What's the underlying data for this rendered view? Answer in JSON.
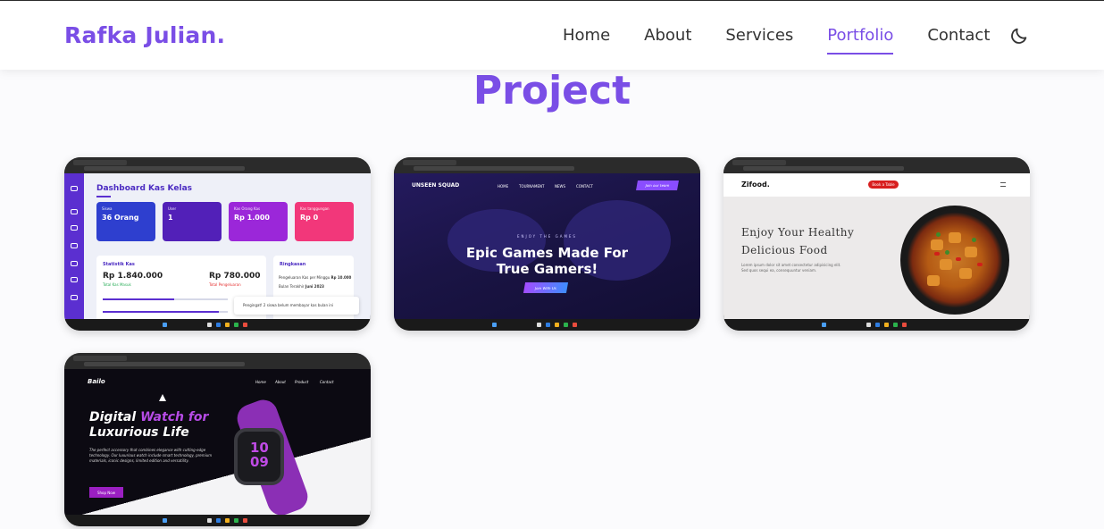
{
  "brand": {
    "name": "Rafka Julian."
  },
  "nav": {
    "items": [
      {
        "label": "Home",
        "active": false
      },
      {
        "label": "About",
        "active": false
      },
      {
        "label": "Services",
        "active": false
      },
      {
        "label": "Portfolio",
        "active": true
      },
      {
        "label": "Contact",
        "active": false
      }
    ],
    "theme_toggle_icon": "moon-icon",
    "accent_color": "#7a4ee6"
  },
  "section": {
    "title": "Project"
  },
  "projects": [
    {
      "screenshot": {
        "title": "Dashboard Kas Kelas",
        "stats": [
          {
            "label": "Siswa",
            "value": "36 Orang",
            "color": "#2e3fcf"
          },
          {
            "label": "User",
            "value": "1",
            "color": "#5220b8"
          },
          {
            "label": "Kas Orang Kas",
            "value": "Rp 1.000",
            "color": "#9b27d9"
          },
          {
            "label": "Kas tanggungan",
            "value": "Rp 0",
            "color": "#f2377a"
          }
        ],
        "statistik_title": "Statistik Kas",
        "amount_in": "Rp 1.840.000",
        "amount_in_label": "Total Kas Masuk",
        "amount_out": "Rp 780.000",
        "amount_out_label": "Total Pengeluaran",
        "ringkasan_title": "Ringkasan",
        "ringkasan_rows": [
          {
            "label": "Pengeluaran Kas per Minggu",
            "value": "Rp 10.000"
          },
          {
            "label": "Bulan Terakhir",
            "value": "Juni 2023"
          }
        ],
        "toast": "Pengingat! 2 siswa belum membayar kas bulan ini"
      }
    },
    {
      "screenshot": {
        "brand": "UNSEEN SQUAD",
        "menu": [
          "HOME",
          "TOURNAMENT",
          "NEWS",
          "CONTACT"
        ],
        "join_label": "Join our team",
        "kicker": "ENJOY THE GAMES",
        "headline_1": "Epic Games Made For",
        "headline_2": "True Gamers!",
        "cta": "Join With Us"
      }
    },
    {
      "screenshot": {
        "brand": "Zifood.",
        "order_label": "Book a Table",
        "headline_1": "Enjoy Your Healthy",
        "headline_2": "Delicious Food",
        "desc": "Lorem ipsum dolor sit amet consectetur adipisicing elit. Sed quos sequi ea, consequuntur veniam."
      }
    },
    {
      "screenshot": {
        "brand": "Bailo",
        "menu": [
          "Home",
          "About",
          "Product",
          "Contact"
        ],
        "headline_1a": "Digital",
        "headline_1b": "Watch for",
        "headline_2": "Luxurious Life",
        "desc": "The perfect accessory that combines elegance with cutting-edge technology. Our luxurious watch include smart technology, premium materials, iconic designs, limited edition and versatility.",
        "button": "Shop Now",
        "watch_time_h": "10",
        "watch_time_m": "09"
      }
    }
  ]
}
